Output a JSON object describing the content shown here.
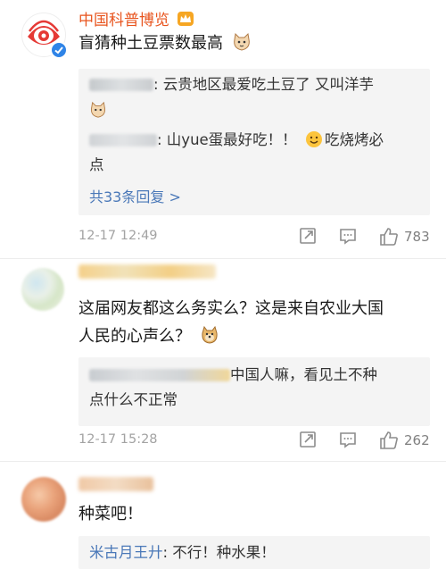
{
  "comments": [
    {
      "author": "中国科普博览",
      "text": "盲猜种土豆票数最高",
      "replies": [
        {
          "text_a": ": 云贵地区最爱吃土豆了 又叫洋芋"
        },
        {
          "text_a": ": 山yue蛋最好吃！！",
          "text_b": "吃烧烤必",
          "text_c": "点"
        }
      ],
      "more_replies": "共33条回复 >",
      "date": "12-17 12:49",
      "likes": "783"
    },
    {
      "text_line1": "这届网友都这么务实么？这是来自农业大国",
      "text_line2": "人民的心声么？",
      "replies": [
        {
          "text_a": "中国人嘛，看见土不种",
          "text_b": "点什么不正常"
        }
      ],
      "date": "12-17 15:28",
      "likes": "262"
    },
    {
      "text": "种菜吧！",
      "replies": [
        {
          "author": "米古月王廾",
          "text": ": 不行！种水果！"
        }
      ]
    }
  ],
  "icons": {
    "verified": "verified-badge-icon",
    "crown": "crown-icon",
    "share": "share-icon",
    "comment": "comment-icon",
    "like": "thumbs-up-icon"
  },
  "colors": {
    "author_orange": "#e8551f",
    "link_blue": "#4a78b8",
    "meta_gray": "#a3a3a3"
  }
}
